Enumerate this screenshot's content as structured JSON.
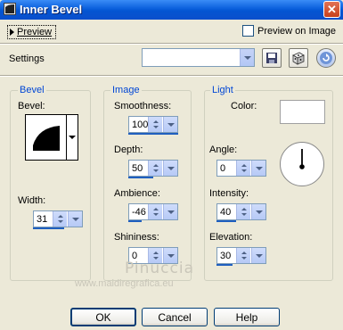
{
  "window": {
    "title": "Inner Bevel",
    "close_label": "✕"
  },
  "top": {
    "preview_label": "Preview",
    "preview_on_image_label": "Preview on Image"
  },
  "settings": {
    "label": "Settings",
    "value": ""
  },
  "bevel": {
    "title": "Bevel",
    "bevel_label": "Bevel:",
    "width_label": "Width:",
    "width_value": "31",
    "width_level": 0.62
  },
  "image": {
    "title": "Image",
    "smoothness_label": "Smoothness:",
    "smoothness_value": "100",
    "smoothness_level": 1.0,
    "depth_label": "Depth:",
    "depth_value": "50",
    "depth_level": 0.5,
    "ambience_label": "Ambience:",
    "ambience_value": "-46",
    "ambience_level": 0.27,
    "shininess_label": "Shininess:",
    "shininess_value": "0",
    "shininess_level": 0.0
  },
  "light": {
    "title": "Light",
    "color_label": "Color:",
    "color_value": "#ffffff",
    "angle_label": "Angle:",
    "angle_value": "0",
    "angle_level": 0.0,
    "intensity_label": "Intensity:",
    "intensity_value": "40",
    "intensity_level": 0.4,
    "elevation_label": "Elevation:",
    "elevation_value": "30",
    "elevation_level": 0.33
  },
  "watermark": {
    "name": "Pinuccia",
    "url": "www.maidiregrafica.eu"
  },
  "buttons": {
    "ok": "OK",
    "cancel": "Cancel",
    "help": "Help"
  },
  "icons": {
    "save": "save-icon",
    "randomize": "dice-icon",
    "reset": "reset-icon",
    "window": "app-icon"
  }
}
